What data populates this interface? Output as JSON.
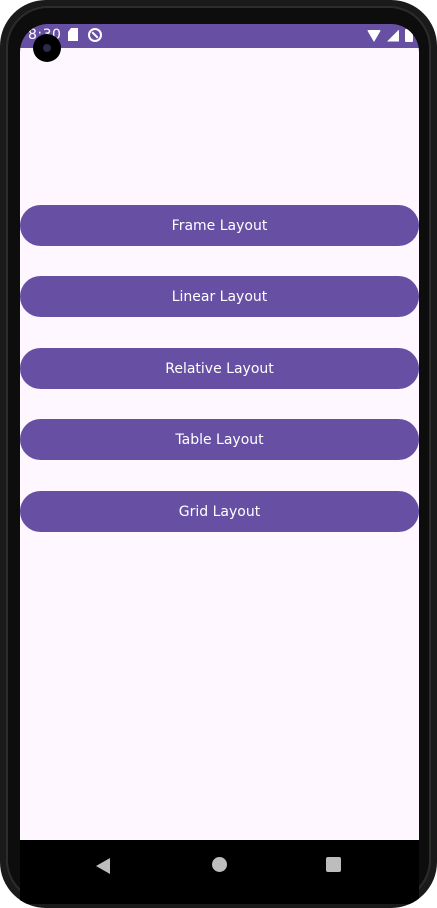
{
  "status_bar": {
    "time": "8:30",
    "icons": [
      "sd-card-icon",
      "do-not-disturb-icon",
      "wifi-icon",
      "signal-icon",
      "battery-icon"
    ]
  },
  "buttons": {
    "frame": "Frame Layout",
    "linear": "Linear Layout",
    "relative": "Relative Layout",
    "table": "Table Layout",
    "grid": "Grid Layout"
  },
  "navigation": {
    "icons": [
      "back-icon",
      "home-icon",
      "recents-icon"
    ]
  },
  "colors": {
    "primary": "#6750a4",
    "background": "#fef7ff",
    "on_primary": "#ffffff"
  }
}
